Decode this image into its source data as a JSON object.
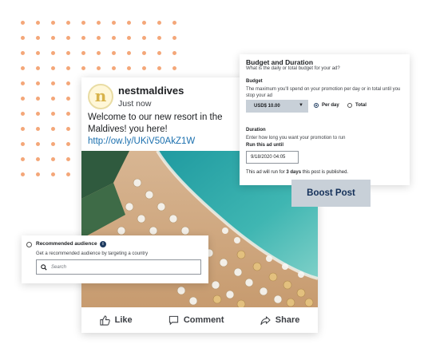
{
  "post": {
    "username": "nestmaldives",
    "time": "Just now",
    "text": "Welcome to our new resort in the Maldives! you here!",
    "link": "http://ow.ly/UKiV50AkZ1W",
    "avatar_letter": "n",
    "actions": {
      "like": "Like",
      "comment": "Comment",
      "share": "Share"
    }
  },
  "budget": {
    "title": "Budget and Duration",
    "subtitle": "What is the daily or total budget for your ad?",
    "budget_label": "Budget",
    "budget_desc": "The maximum you'll spend on your promotion per day or in total until you stop your ad",
    "amount": "USD$ 10.00",
    "option_per_day": "Per day",
    "option_total": "Total",
    "selected_option": "Per day",
    "duration_label": "Duration",
    "duration_desc": "Enter how long you want your promotion to run",
    "run_until_label": "Run this ad until",
    "run_until_value": "9/18/2020 04:05",
    "footer_prefix": "This ad will run for ",
    "footer_days": "3 days",
    "footer_suffix": " this post is published."
  },
  "boost_button": "Boost Post",
  "audience": {
    "title": "Recommended audience",
    "info_icon": "i",
    "description": "Get a recommended audience by targeting a country",
    "search_placeholder": "Search"
  },
  "colors": {
    "dots": "#f4a779",
    "boost_bg": "#c8d0d8",
    "boost_text": "#143059",
    "link": "#1a6fae"
  }
}
